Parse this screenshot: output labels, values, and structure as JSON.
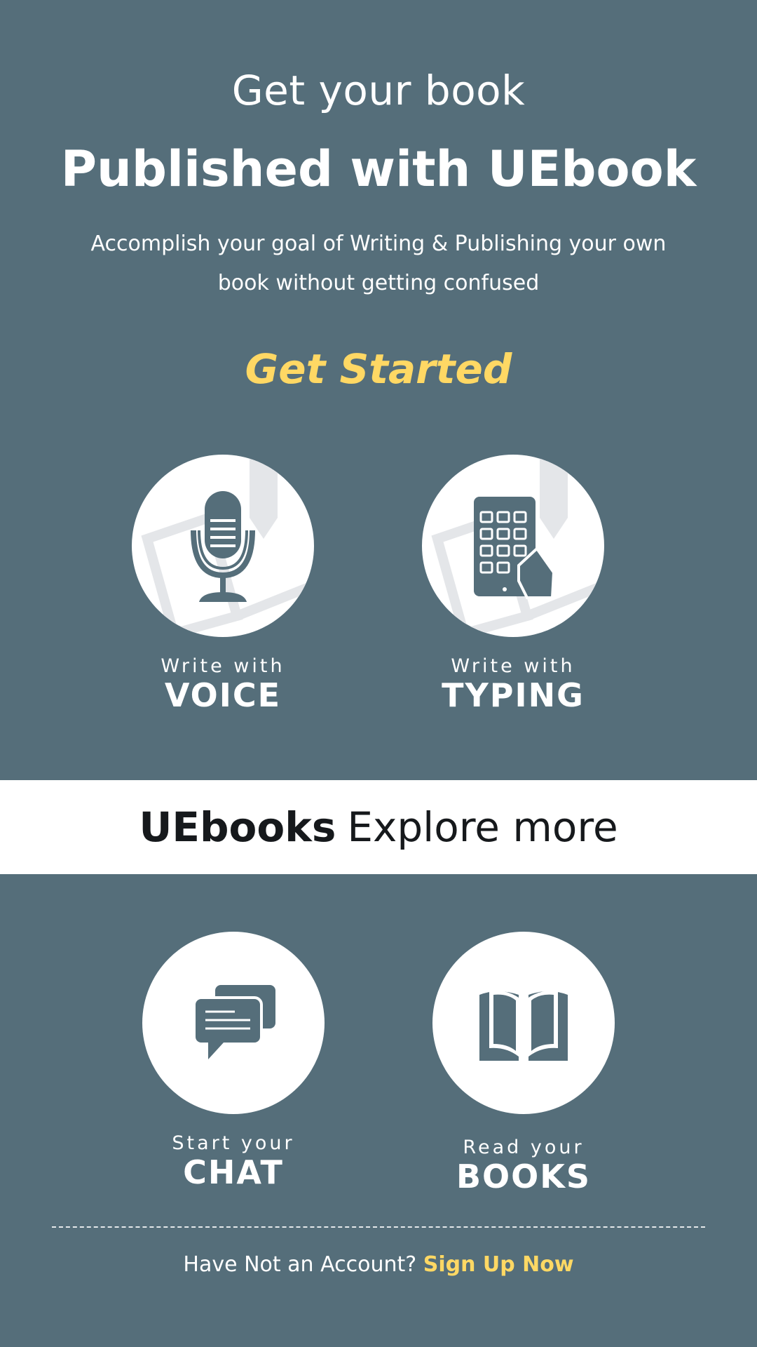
{
  "hero": {
    "line1": "Get your book",
    "line2": "Published with UEbook",
    "subtitle_line1": "Accomplish your goal of Writing & Publishing your own",
    "subtitle_line2": "book without getting confused",
    "cta": "Get Started"
  },
  "write_options": [
    {
      "small": "Write with",
      "big": "VOICE",
      "icon": "microphone-icon"
    },
    {
      "small": "Write with",
      "big": "TYPING",
      "icon": "tablet-icon"
    }
  ],
  "explore_band": {
    "brand": "UEbooks",
    "label": "Explore more"
  },
  "more_options": [
    {
      "small": "Start your",
      "big": "CHAT",
      "icon": "chat-bubbles-icon"
    },
    {
      "small": "Read your",
      "big": "BOOKS",
      "icon": "open-book-icon"
    }
  ],
  "footer": {
    "prompt": "Have Not an Account?",
    "link": "Sign Up Now"
  },
  "colors": {
    "background": "#556e7a",
    "accent": "#ffd864",
    "band": "#ffffff",
    "icon": "#556e7a"
  }
}
